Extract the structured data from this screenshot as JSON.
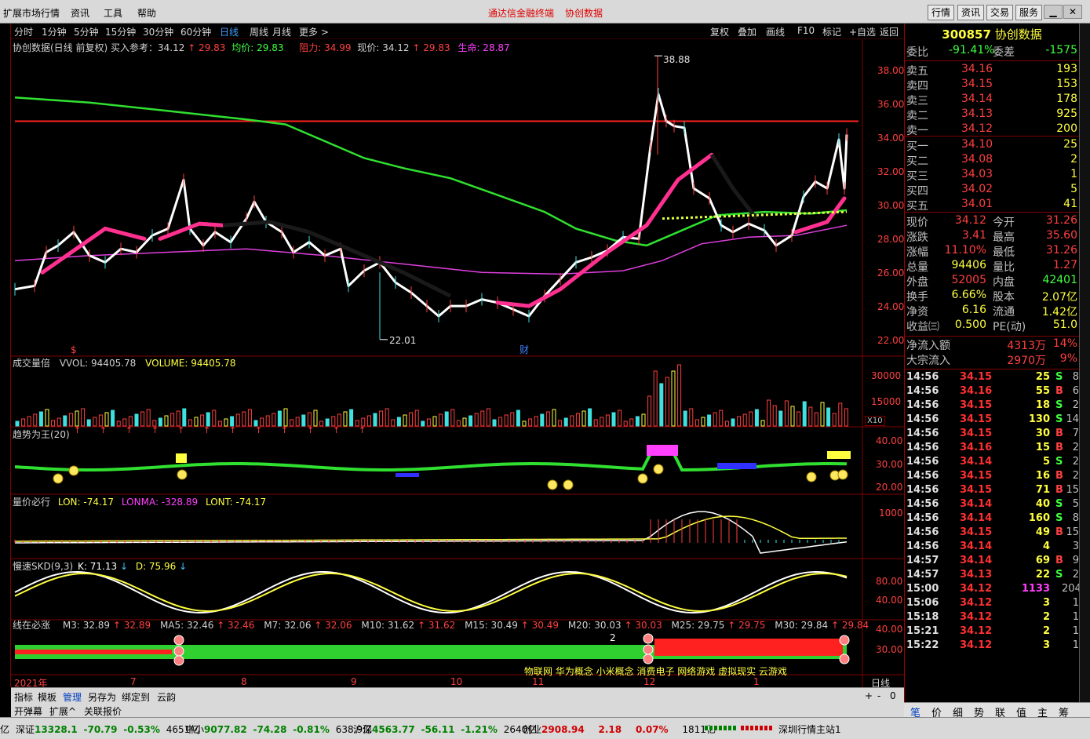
{
  "menu": {
    "items": [
      "扩展市场行情",
      "资讯",
      "工具",
      "帮助"
    ],
    "announcements": [
      "通达信金融终端",
      "协创数据"
    ],
    "top_buttons": [
      "行情",
      "资讯",
      "交易",
      "服务"
    ]
  },
  "periods": {
    "items": [
      "分时",
      "1分钟",
      "5分钟",
      "15分钟",
      "30分钟",
      "60分钟",
      "日线",
      "周线",
      "月线",
      "更多 >"
    ],
    "active": "日线",
    "tools": [
      "复权",
      "叠加",
      "画线",
      "F10",
      "标记",
      "+自选",
      "返回"
    ]
  },
  "main_chart": {
    "legend": [
      {
        "text": "协创数据(日线 前复权) 买入参考：34.12",
        "color": "#d0d0d0"
      },
      {
        "text": "↑ 29.83",
        "color": "#ff4040"
      },
      {
        "text": "均价: 29.83",
        "color": "#40ff40"
      },
      {
        "text": "阻力: 34.99",
        "color": "#ff4040"
      },
      {
        "text": "现价: 34.12",
        "color": "#d0d0d0"
      },
      {
        "text": "↑ 29.83",
        "color": "#ff4040"
      },
      {
        "text": "生命: 28.87",
        "color": "#ff40ff"
      }
    ],
    "price_axis": [
      "38.00",
      "36.00",
      "34.00",
      "32.00",
      "30.00",
      "28.00",
      "26.00",
      "24.00",
      "22.00"
    ],
    "high_label": "38.88",
    "low_label": "22.01",
    "marker_cai": "财",
    "marker_dollar": "$"
  },
  "volume_panel": {
    "title": "成交量倍",
    "vol": "VVOL: 94405.78",
    "volume": "VOLUME: 94405.78",
    "axis": [
      "30000",
      "15000"
    ],
    "unit": "X10"
  },
  "trend_panel": {
    "title": "趋势为王(20)",
    "axis": [
      "40.00",
      "30.00",
      "20.00"
    ]
  },
  "lon_panel": {
    "title": "量价必行",
    "lon": "LON: -74.17",
    "lonma": "LONMA: -328.89",
    "lont": "LONT: -74.17",
    "axis": [
      "1000"
    ]
  },
  "skd_panel": {
    "title": "慢速SKD(9,3)",
    "k": "K: 71.13",
    "d": "D: 75.96",
    "axis": [
      "80.00",
      "40.00"
    ]
  },
  "ma_panel": {
    "title": "线在必涨",
    "items": [
      "M3: 32.89",
      "↑ 32.89",
      "MA5: 32.46",
      "↑ 32.46",
      "M7: 32.06",
      "↑ 32.06",
      "M10: 31.62",
      "↑ 31.62",
      "M15: 30.49",
      "↑ 30.49",
      "M20: 30.03",
      "↑ 30.03",
      "M25: 29.75",
      "↑ 29.75",
      "M30: 29.84",
      "↑ 29.84"
    ],
    "axis": [
      "40.00",
      "30.00"
    ],
    "marker": "2",
    "concepts": "物联网 华为概念 小米概念 消费电子 网络游戏 虚拟现实 云游戏"
  },
  "date_axis": {
    "items": [
      "2021年",
      "7",
      "8",
      "9",
      "10",
      "11",
      "12",
      "1"
    ],
    "period_label": "日线",
    "zoom": [
      "+",
      "-",
      "0"
    ]
  },
  "bottom_tabs": {
    "row1": [
      "指标",
      "模板",
      "管理",
      "另存为",
      "绑定到",
      "云韵"
    ],
    "row1_active": "管理",
    "row2": [
      "开弹幕",
      "扩展^",
      "关联报价"
    ]
  },
  "quote": {
    "code": "300857",
    "name": "协创数据",
    "weibi_label": "委比",
    "weibi": "-91.41%",
    "weicha_label": "委差",
    "weicha": "-1575",
    "sell": [
      {
        "label": "卖五",
        "price": "34.16",
        "vol": "193"
      },
      {
        "label": "卖四",
        "price": "34.15",
        "vol": "153"
      },
      {
        "label": "卖三",
        "price": "34.14",
        "vol": "178"
      },
      {
        "label": "卖二",
        "price": "34.13",
        "vol": "925"
      },
      {
        "label": "卖一",
        "price": "34.12",
        "vol": "200"
      }
    ],
    "buy": [
      {
        "label": "买一",
        "price": "34.10",
        "vol": "25"
      },
      {
        "label": "买二",
        "price": "34.08",
        "vol": "2"
      },
      {
        "label": "买三",
        "price": "34.03",
        "vol": "1"
      },
      {
        "label": "买四",
        "price": "34.02",
        "vol": "5"
      },
      {
        "label": "买五",
        "price": "34.01",
        "vol": "41"
      }
    ],
    "stats": [
      {
        "l1": "现价",
        "v1": "34.12",
        "c1": "#ff4040",
        "l2": "今开",
        "v2": "31.26",
        "c2": "#ff4040"
      },
      {
        "l1": "涨跌",
        "v1": "3.41",
        "c1": "#ff4040",
        "l2": "最高",
        "v2": "35.60",
        "c2": "#ff4040"
      },
      {
        "l1": "涨幅",
        "v1": "11.10%",
        "c1": "#ff4040",
        "l2": "最低",
        "v2": "31.26",
        "c2": "#ff4040"
      },
      {
        "l1": "总量",
        "v1": "94406",
        "c1": "#ffff40",
        "l2": "量比",
        "v2": "1.27",
        "c2": "#ff4040"
      },
      {
        "l1": "外盘",
        "v1": "52005",
        "c1": "#ff4040",
        "l2": "内盘",
        "v2": "42401",
        "c2": "#40ff40"
      },
      {
        "l1": "换手",
        "v1": "6.66%",
        "c1": "#ffff40",
        "l2": "股本",
        "v2": "2.07亿",
        "c2": "#ffff40"
      },
      {
        "l1": "净资",
        "v1": "6.16",
        "c1": "#ffff40",
        "l2": "流通",
        "v2": "1.42亿",
        "c2": "#ffff40"
      },
      {
        "l1": "收益㈢",
        "v1": "0.500",
        "c1": "#ffff40",
        "l2": "PE(动)",
        "v2": "51.0",
        "c2": "#ffff40"
      }
    ],
    "flow": [
      {
        "label": "净流入额",
        "value": "4313万",
        "pct": "14%"
      },
      {
        "label": "大宗流入",
        "value": "2970万",
        "pct": "9%"
      }
    ],
    "ticks": [
      {
        "t": "14:56",
        "p": "34.15",
        "v": "25",
        "s": "S",
        "n": "8"
      },
      {
        "t": "14:56",
        "p": "34.16",
        "v": "55",
        "s": "B",
        "n": "6"
      },
      {
        "t": "14:56",
        "p": "34.15",
        "v": "18",
        "s": "S",
        "n": "2"
      },
      {
        "t": "14:56",
        "p": "34.15",
        "v": "130",
        "s": "S",
        "n": "14"
      },
      {
        "t": "14:56",
        "p": "34.15",
        "v": "30",
        "s": "B",
        "n": "7"
      },
      {
        "t": "14:56",
        "p": "34.16",
        "v": "15",
        "s": "B",
        "n": "2"
      },
      {
        "t": "14:56",
        "p": "34.14",
        "v": "5",
        "s": "S",
        "n": "2"
      },
      {
        "t": "14:56",
        "p": "34.15",
        "v": "16",
        "s": "B",
        "n": "2"
      },
      {
        "t": "14:56",
        "p": "34.15",
        "v": "71",
        "s": "B",
        "n": "15"
      },
      {
        "t": "14:56",
        "p": "34.14",
        "v": "40",
        "s": "S",
        "n": "5"
      },
      {
        "t": "14:56",
        "p": "34.14",
        "v": "160",
        "s": "S",
        "n": "8"
      },
      {
        "t": "14:56",
        "p": "34.15",
        "v": "49",
        "s": "B",
        "n": "15"
      },
      {
        "t": "14:56",
        "p": "34.14",
        "v": "4",
        "s": "",
        "n": "3"
      },
      {
        "t": "14:57",
        "p": "34.14",
        "v": "69",
        "s": "B",
        "n": "9"
      },
      {
        "t": "14:57",
        "p": "34.13",
        "v": "22",
        "s": "S",
        "n": "2"
      },
      {
        "t": "15:00",
        "p": "34.12",
        "v": "1133",
        "s": "",
        "n": "204"
      },
      {
        "t": "15:06",
        "p": "34.12",
        "v": "3",
        "s": "",
        "n": "1"
      },
      {
        "t": "15:18",
        "p": "34.12",
        "v": "2",
        "s": "",
        "n": "1"
      },
      {
        "t": "15:21",
        "p": "34.12",
        "v": "2",
        "s": "",
        "n": "1"
      },
      {
        "t": "15:22",
        "p": "34.12",
        "v": "3",
        "s": "",
        "n": "1"
      }
    ],
    "tabs": [
      "笔",
      "价",
      "细",
      "势",
      "联",
      "值",
      "主",
      "筹"
    ]
  },
  "status": {
    "items": [
      {
        "name": "深证",
        "val": "13328.1",
        "chg": "-70.79",
        "pct": "-0.53%",
        "amt": "4651亿"
      },
      {
        "name": "中小",
        "val": "9077.82",
        "chg": "-74.28",
        "pct": "-0.81%",
        "amt": "638.9亿"
      },
      {
        "name": "沪深",
        "val": "4563.77",
        "chg": "-56.11",
        "pct": "-1.21%",
        "amt": "2640亿"
      },
      {
        "name": "创业",
        "val": "2908.94",
        "chg": "2.18",
        "pct": "0.07%",
        "amt": "1811亿"
      }
    ],
    "lead": "亿",
    "station": "深圳行情主站1"
  },
  "colors": {
    "up": "#ff4040",
    "down": "#40ff40",
    "accent": "#ffff40",
    "bg": "#000000"
  }
}
